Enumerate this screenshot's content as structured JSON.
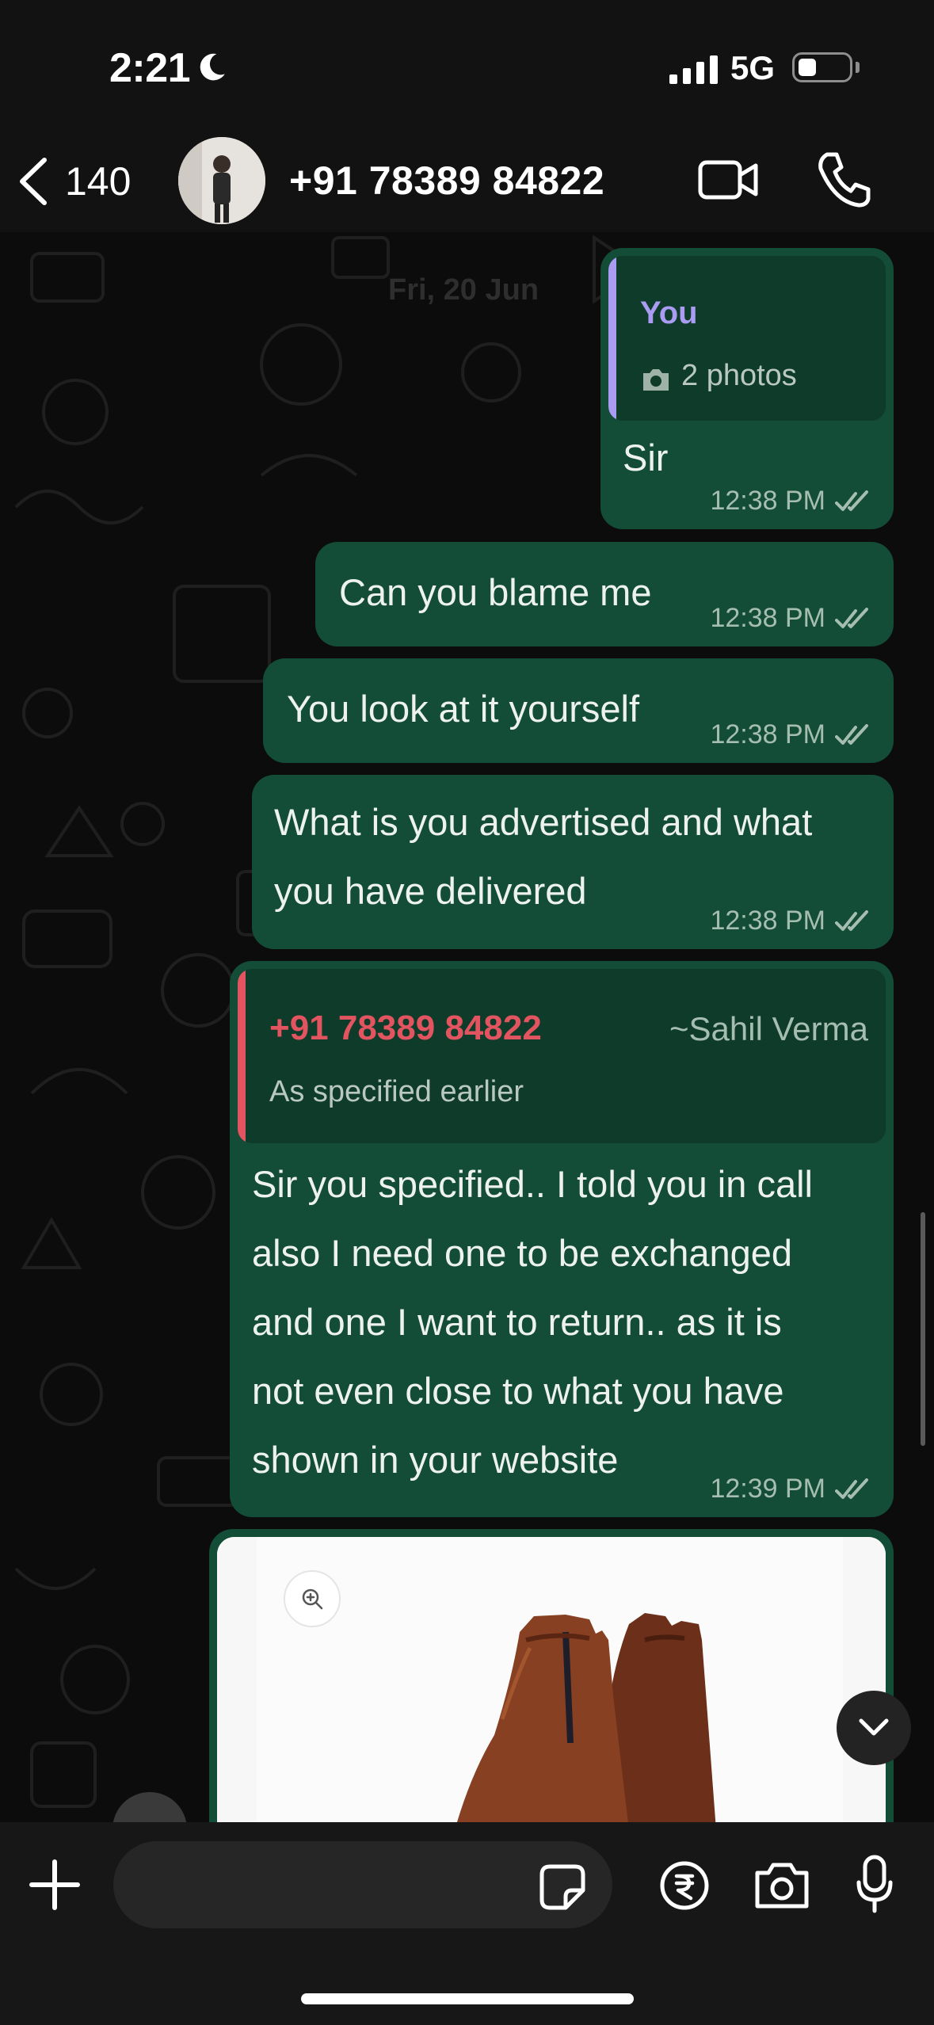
{
  "status_bar": {
    "time": "2:21",
    "network": "5G",
    "icons": [
      "moon-icon",
      "signal-icon",
      "battery-icon"
    ]
  },
  "header": {
    "back_count": "140",
    "contact": "+91 78389 84822",
    "icons": [
      "chevron-left-icon",
      "video-call-icon",
      "phone-icon"
    ]
  },
  "chat": {
    "date": "Fri, 20 Jun",
    "messages": [
      {
        "quote": {
          "author": "You",
          "content": "2 photos",
          "icon": "camera-icon"
        },
        "text": "Sir",
        "time": "12:38 PM",
        "status": "read"
      },
      {
        "text": "Can you blame me",
        "time": "12:38 PM",
        "status": "read"
      },
      {
        "text": "You look at it yourself",
        "time": "12:38 PM",
        "status": "read"
      },
      {
        "text_lines": [
          "What is you advertised and what",
          "you have delivered"
        ],
        "time": "12:38 PM",
        "status": "read"
      },
      {
        "quote": {
          "author": "+91 78389 84822",
          "author_alias": "~Sahil Verma",
          "content": "As specified earlier"
        },
        "text_lines": [
          "Sir you specified.. I told you in call",
          "also I need one to be exchanged",
          "and one I want to return.. as it is",
          "not even close to what you have",
          "shown in your website"
        ],
        "time": "12:39 PM",
        "status": "read"
      }
    ]
  },
  "composer": {
    "placeholder": "",
    "icons": [
      "plus-icon",
      "sticker-icon",
      "rupee-icon",
      "camera-icon",
      "mic-icon"
    ]
  },
  "colors": {
    "bubble_out": "#134d37",
    "quote_bg": "#0f3b2a",
    "you_author": "#a99cf2",
    "contact_author": "#e2545f",
    "read_ticks": "#a6bdb2"
  }
}
